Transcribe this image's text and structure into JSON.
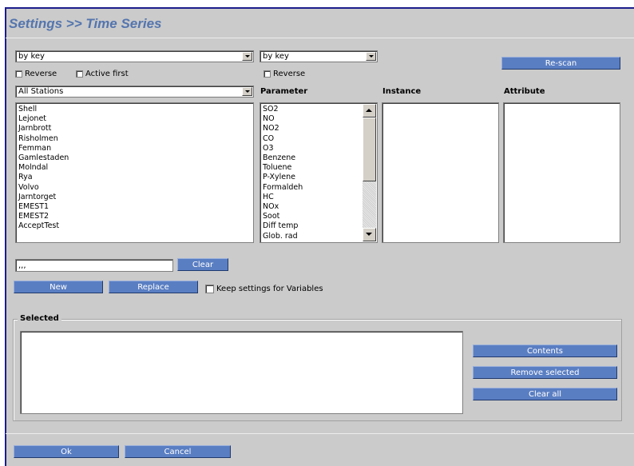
{
  "header": {
    "title": "Settings >> Time Series"
  },
  "sort": {
    "left_select": "by key",
    "right_select": "by key",
    "reverse_label": "Reverse",
    "active_first_label": "Active first",
    "reverse2_label": "Reverse",
    "rescan_label": "Re-scan"
  },
  "stations": {
    "filter_select": "All Stations",
    "items": [
      "Shell",
      "Lejonet",
      "Jarnbrott",
      "Risholmen",
      "Femman",
      "Gamlestaden",
      "Molndal",
      "Rya",
      "Volvo",
      "Jarntorget",
      "EMEST1",
      "EMEST2",
      "AcceptTest"
    ]
  },
  "columns": {
    "parameter": "Parameter",
    "instance": "Instance",
    "attribute": "Attribute"
  },
  "parameters": {
    "items": [
      "SO2",
      "NO",
      "NO2",
      "CO",
      "O3",
      "Benzene",
      "Toluene",
      "P-Xylene",
      "Formaldeh",
      "HC",
      "NOx",
      "Soot",
      "Diff temp",
      "Glob. rad"
    ]
  },
  "filter": {
    "value": ",,,",
    "clear_label": "Clear"
  },
  "actions": {
    "new_label": "New",
    "replace_label": "Replace",
    "keep_settings_label": "Keep settings for Variables"
  },
  "selected": {
    "legend": "Selected",
    "contents_label": "Contents",
    "remove_selected_label": "Remove selected",
    "clear_all_label": "Clear all"
  },
  "footer": {
    "ok_label": "Ok",
    "cancel_label": "Cancel"
  }
}
